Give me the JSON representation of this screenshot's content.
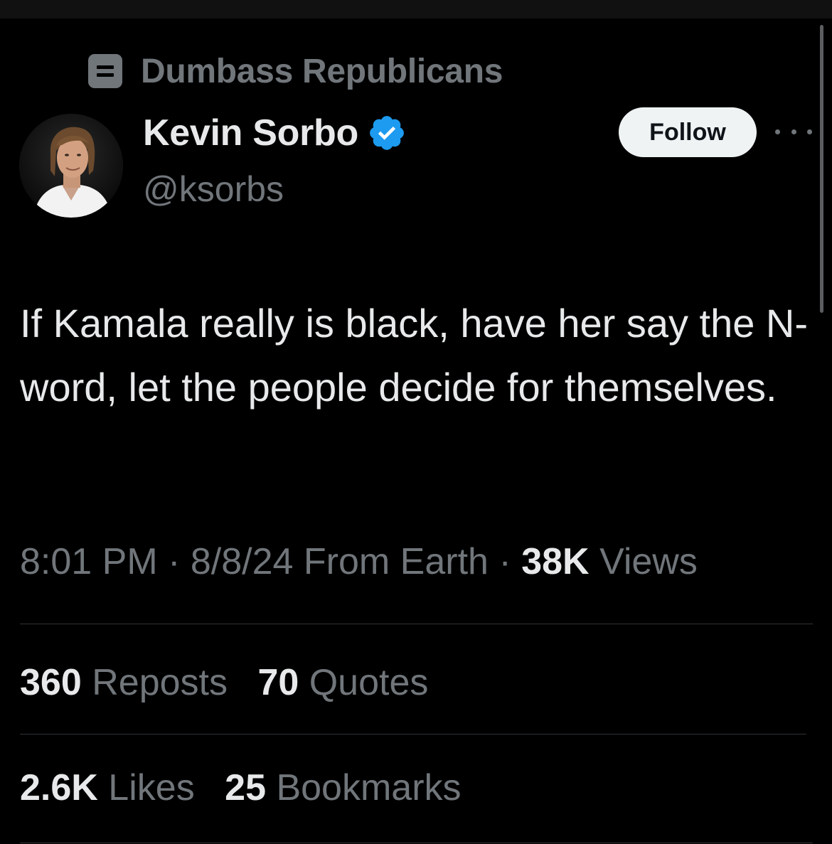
{
  "community": {
    "icon": "community-icon",
    "name": "Dumbass Republicans"
  },
  "author": {
    "display_name": "Kevin Sorbo",
    "handle": "@ksorbs",
    "verified": true,
    "verified_color": "#1d9bf0"
  },
  "actions": {
    "follow_label": "Follow",
    "more_icon": "more-icon"
  },
  "tweet": {
    "text": "If Kamala really is black, have her say the N-word, let the people decide for themselves."
  },
  "meta": {
    "time": "8:01 PM",
    "separator": "·",
    "date": "8/8/24",
    "source": "From Earth",
    "views_count": "38K",
    "views_label": "Views"
  },
  "stats": {
    "reposts": {
      "count": "360",
      "label": "Reposts"
    },
    "quotes": {
      "count": "70",
      "label": "Quotes"
    },
    "likes": {
      "count": "2.6K",
      "label": "Likes"
    },
    "bookmarks": {
      "count": "25",
      "label": "Bookmarks"
    }
  },
  "colors": {
    "background": "#000000",
    "text_primary": "#e7e9ea",
    "text_secondary": "#71767b",
    "divider": "#2f3336",
    "follow_button_bg": "#eff3f4"
  }
}
